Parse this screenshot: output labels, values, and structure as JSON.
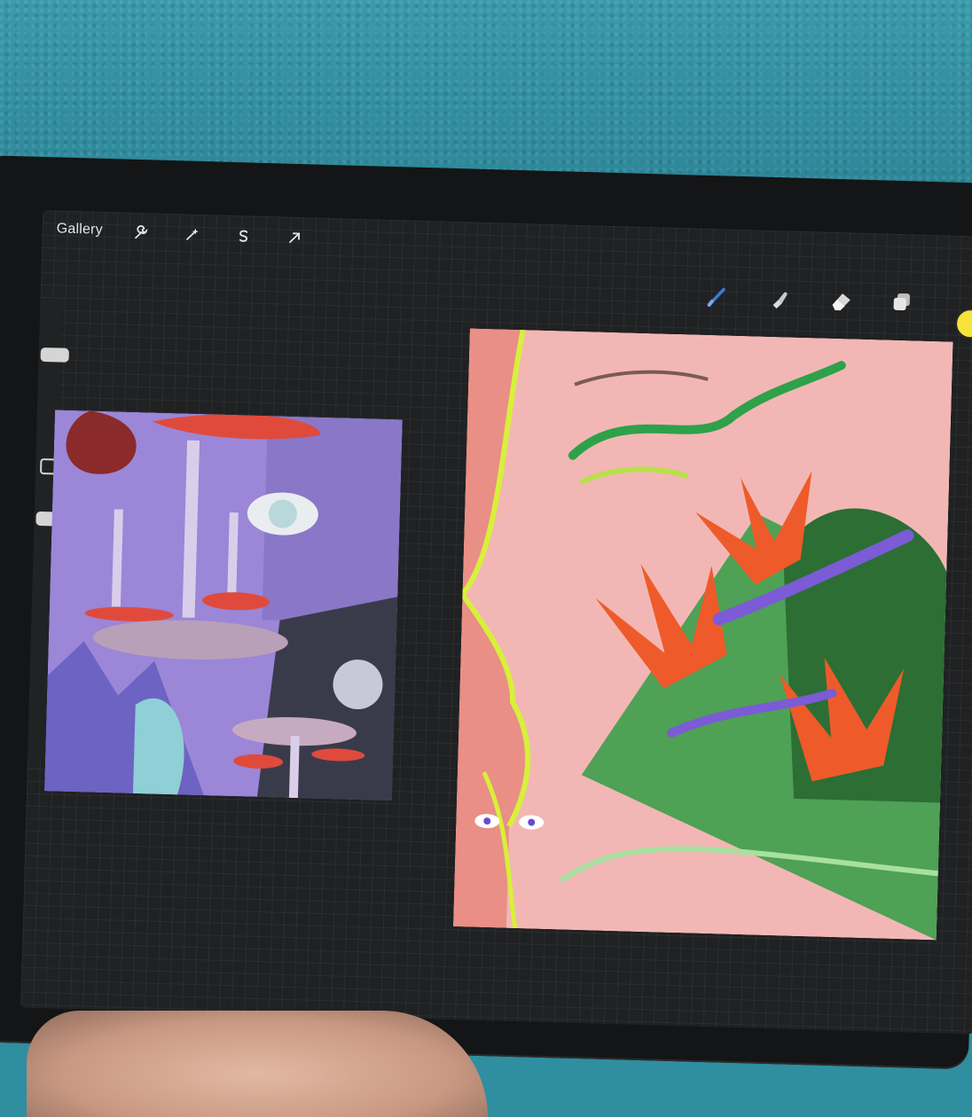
{
  "toolbar": {
    "gallery_label": "Gallery",
    "left_tools": [
      {
        "icon": "wrench-icon"
      },
      {
        "icon": "magic-wand-icon"
      },
      {
        "icon": "selection-s-icon"
      },
      {
        "icon": "transform-arrow-icon"
      }
    ],
    "right_tools": [
      {
        "icon": "brush-icon",
        "active": true,
        "color": "#3b7bd9"
      },
      {
        "icon": "smudge-icon"
      },
      {
        "icon": "eraser-icon"
      },
      {
        "icon": "layers-icon"
      }
    ],
    "current_color": "#f6e33a"
  },
  "colors": {
    "left_art_bg": "#9b86d8",
    "right_art_bg": "#e98f86",
    "screen_bg": "#1f2123",
    "carpet": "#2f8e9f"
  }
}
